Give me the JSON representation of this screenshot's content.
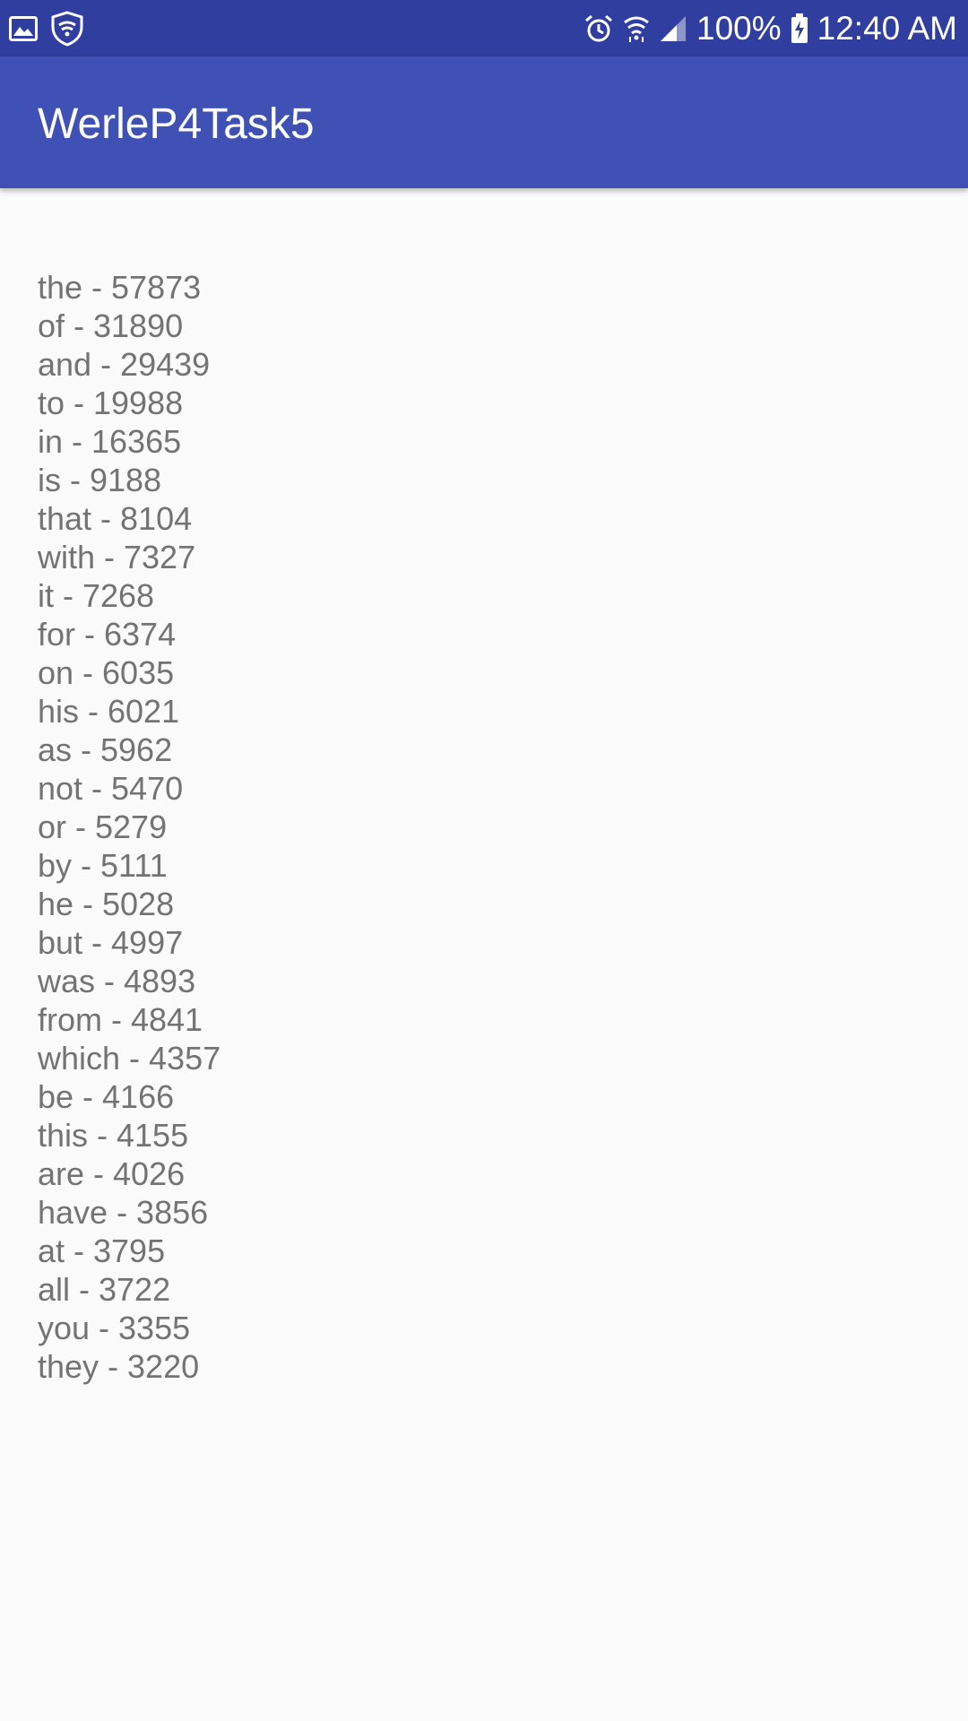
{
  "status_bar": {
    "left_icons": [
      "image-icon",
      "shield-icon"
    ],
    "right_icons": [
      "alarm-icon",
      "wifi-icon",
      "signal-icon",
      "battery-charging-icon"
    ],
    "battery": "100%",
    "time": "12:40 AM"
  },
  "app_bar": {
    "title": "WerleP4Task5"
  },
  "word_counts": [
    "the - 57873",
    "of - 31890",
    "and - 29439",
    "to - 19988",
    "in - 16365",
    "is - 9188",
    "that - 8104",
    "with - 7327",
    "it - 7268",
    "for - 6374",
    "on - 6035",
    "his - 6021",
    "as - 5962",
    "not - 5470",
    "or - 5279",
    "by - 5111",
    "he - 5028",
    "but - 4997",
    "was - 4893",
    "from - 4841",
    "which - 4357",
    "be - 4166",
    "this - 4155",
    "are - 4026",
    "have - 3856",
    "at - 3795",
    "all - 3722",
    "you - 3355",
    "they - 3220"
  ],
  "colors": {
    "status_bar": "#303f9f",
    "app_bar": "#3f51b5",
    "background": "#fafafa",
    "list_text": "#737373"
  }
}
